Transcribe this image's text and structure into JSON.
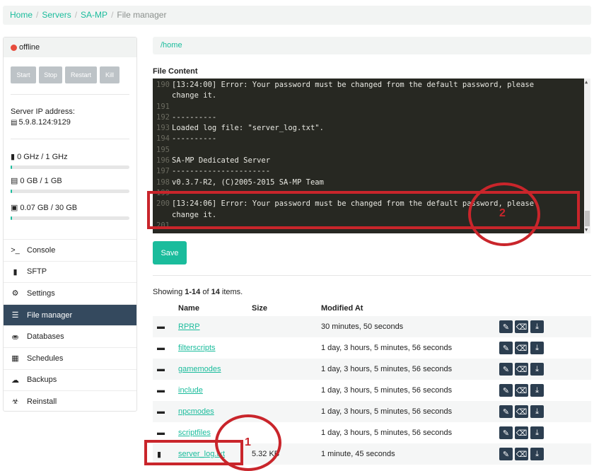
{
  "breadcrumb": {
    "items": [
      "Home",
      "Servers",
      "SA-MP"
    ],
    "current": "File manager",
    "separator": "/"
  },
  "sidebar": {
    "status": "offline",
    "status_color": "#e74c3c",
    "power_buttons": [
      "Start",
      "Stop",
      "Restart",
      "Kill"
    ],
    "ip_label": "Server IP address:",
    "ip_value": "5.9.8.124:9129",
    "resources": [
      {
        "icon": "cpu-icon",
        "text": "0 GHz / 1 GHz",
        "fraction": 0.01
      },
      {
        "icon": "memory-icon",
        "text": "0 GB / 1 GB",
        "fraction": 0.01
      },
      {
        "icon": "disk-icon",
        "text": "0.07 GB / 30 GB",
        "fraction": 0.01
      }
    ],
    "nav": [
      {
        "icon": "terminal-icon",
        "label": "Console",
        "active": false
      },
      {
        "icon": "file-icon",
        "label": "SFTP",
        "active": false
      },
      {
        "icon": "gears-icon",
        "label": "Settings",
        "active": false
      },
      {
        "icon": "list-icon",
        "label": "File manager",
        "active": true
      },
      {
        "icon": "database-icon",
        "label": "Databases",
        "active": false
      },
      {
        "icon": "calendar-icon",
        "label": "Schedules",
        "active": false
      },
      {
        "icon": "cloud-icon",
        "label": "Backups",
        "active": false
      },
      {
        "icon": "reinstall-icon",
        "label": "Reinstall",
        "active": false
      }
    ]
  },
  "path": "/home",
  "file_content_label": "File Content",
  "editor": {
    "lines": [
      {
        "n": "190",
        "t": "[13:24:00] Error: Your password must be changed from the default password, please"
      },
      {
        "n": "",
        "t": "change it."
      },
      {
        "n": "191",
        "t": ""
      },
      {
        "n": "192",
        "t": "----------"
      },
      {
        "n": "193",
        "t": "Loaded log file: \"server_log.txt\"."
      },
      {
        "n": "194",
        "t": "----------"
      },
      {
        "n": "195",
        "t": ""
      },
      {
        "n": "196",
        "t": "SA-MP Dedicated Server"
      },
      {
        "n": "197",
        "t": "----------------------"
      },
      {
        "n": "198",
        "t": "v0.3.7-R2, (C)2005-2015 SA-MP Team"
      },
      {
        "n": "199",
        "t": ""
      },
      {
        "n": "200",
        "t": "[13:24:06] Error: Your password must be changed from the default password, please"
      },
      {
        "n": "",
        "t": "change it."
      },
      {
        "n": "201",
        "t": ""
      }
    ]
  },
  "save_label": "Save",
  "summary": {
    "prefix": "Showing ",
    "range": "1-14",
    "of": " of ",
    "total": "14",
    "suffix": " items."
  },
  "table": {
    "headers": {
      "name": "Name",
      "size": "Size",
      "modified": "Modified At"
    },
    "rows": [
      {
        "type": "folder",
        "name": "RPRP",
        "size": "",
        "modified": "30 minutes, 50 seconds"
      },
      {
        "type": "folder",
        "name": "filterscripts",
        "size": "",
        "modified": "1 day, 3 hours, 5 minutes, 56 seconds"
      },
      {
        "type": "folder",
        "name": "gamemodes",
        "size": "",
        "modified": "1 day, 3 hours, 5 minutes, 56 seconds"
      },
      {
        "type": "folder",
        "name": "include",
        "size": "",
        "modified": "1 day, 3 hours, 5 minutes, 56 seconds"
      },
      {
        "type": "folder",
        "name": "npcmodes",
        "size": "",
        "modified": "1 day, 3 hours, 5 minutes, 56 seconds"
      },
      {
        "type": "folder",
        "name": "scriptfiles",
        "size": "",
        "modified": "1 day, 3 hours, 5 minutes, 56 seconds"
      },
      {
        "type": "file",
        "name": "server_log.txt",
        "size": "5.32 KB",
        "modified": "1 minute, 45 seconds"
      }
    ]
  },
  "annotations": [
    {
      "label": "1",
      "color": "#c9252b"
    },
    {
      "label": "2",
      "color": "#c9252b"
    }
  ]
}
